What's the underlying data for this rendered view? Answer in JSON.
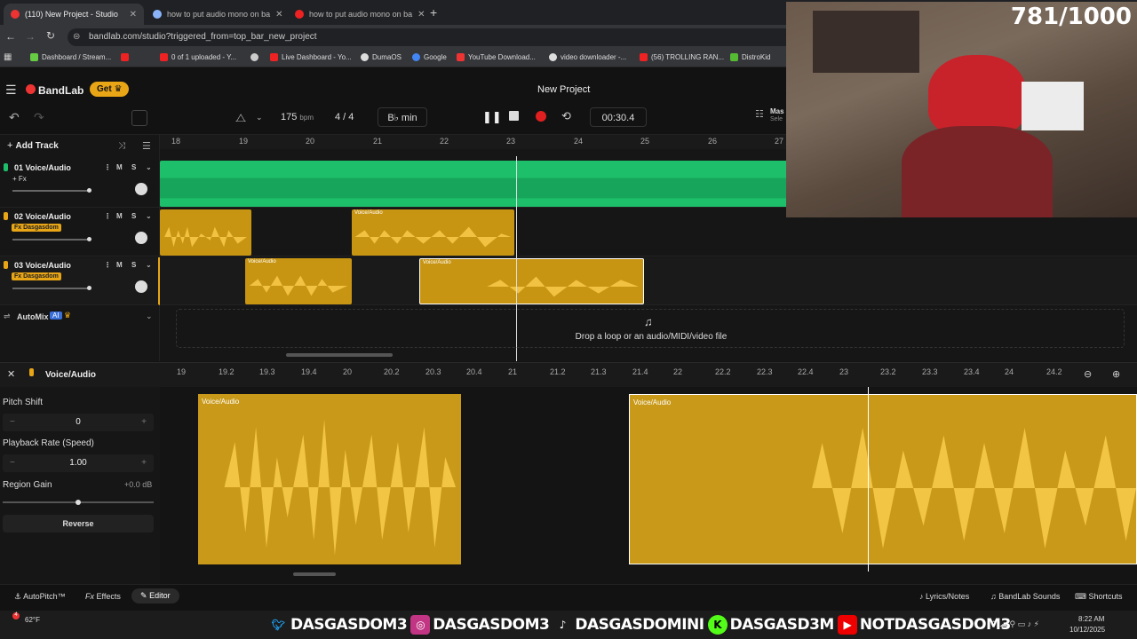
{
  "browser": {
    "tabs": [
      {
        "title": "(110) New Project - Studio",
        "active": true
      },
      {
        "title": "how to put audio mono on ba",
        "active": false
      },
      {
        "title": "how to put audio mono on ba",
        "active": false
      }
    ],
    "url": "bandlab.com/studio?triggered_from=top_bar_new_project",
    "bookmarks": [
      "Dashboard / Stream...",
      "0 of 1 uploaded - Y...",
      "Live Dashboard - Yo...",
      "DumaOS",
      "Google",
      "YouTube Download...",
      "video downloader -...",
      "(56) TROLLING RAN...",
      "DistroKid"
    ]
  },
  "app": {
    "brand": "BandLab",
    "get_label": "Get",
    "project_title": "New Project",
    "tempo": "175",
    "tempo_unit": "bpm",
    "time_sig": "4 / 4",
    "key": "B♭ min",
    "time": "00:30.4",
    "master_label": "Mas",
    "master_sub": "Sele",
    "add_track": "Add Track",
    "automix": "AutoMix",
    "ai_badge": "AI",
    "drop_text": "Drop a loop or an audio/MIDI/video file"
  },
  "ruler": [
    "18",
    "19",
    "20",
    "21",
    "22",
    "23",
    "24",
    "25",
    "26",
    "27"
  ],
  "tracks": [
    {
      "num": "01",
      "name": "Voice/Audio",
      "fx": "+ Fx"
    },
    {
      "num": "02",
      "name": "Voice/Audio",
      "fx": "Fx Dasgasdom"
    },
    {
      "num": "03",
      "name": "Voice/Audio",
      "fx": "Fx Dasgasdom"
    }
  ],
  "clip_label": "Voice/Audio",
  "editor": {
    "title": "Voice/Audio",
    "ruler": [
      "19",
      "19.2",
      "19.3",
      "19.4",
      "20",
      "20.2",
      "20.3",
      "20.4",
      "21",
      "21.2",
      "21.3",
      "21.4",
      "22",
      "22.2",
      "22.3",
      "22.4",
      "23",
      "23.2",
      "23.3",
      "23.4",
      "24",
      "24.2"
    ],
    "pitch_label": "Pitch Shift",
    "pitch_value": "0",
    "rate_label": "Playback Rate (Speed)",
    "rate_value": "1.00",
    "gain_label": "Region Gain",
    "gain_value": "+0.0 dB",
    "reverse_label": "Reverse"
  },
  "bottom": {
    "autopitch": "AutoPitch™",
    "effects": "Effects",
    "editor": "Editor",
    "lyrics": "Lyrics/Notes",
    "sounds": "BandLab Sounds",
    "shortcuts": "Shortcuts"
  },
  "webcam": {
    "counter": "781/1000"
  },
  "taskbar": {
    "weather": "62°F",
    "time": "8:22 AM",
    "date": "10/12/2025",
    "socials": [
      {
        "icon": "twitter-icon",
        "handle": "DASGASDOM3"
      },
      {
        "icon": "instagram-icon",
        "handle": "DASGASDOM3"
      },
      {
        "icon": "tiktok-icon",
        "handle": "DASGASDOMINI"
      },
      {
        "icon": "kick-icon",
        "handle": "DASGASD3M"
      },
      {
        "icon": "youtube-icon",
        "handle": "NOTDASGASDOM3"
      }
    ]
  },
  "colors": {
    "accent": "#e8a516",
    "green_clip": "#1dbf6a",
    "record": "#e02020"
  }
}
